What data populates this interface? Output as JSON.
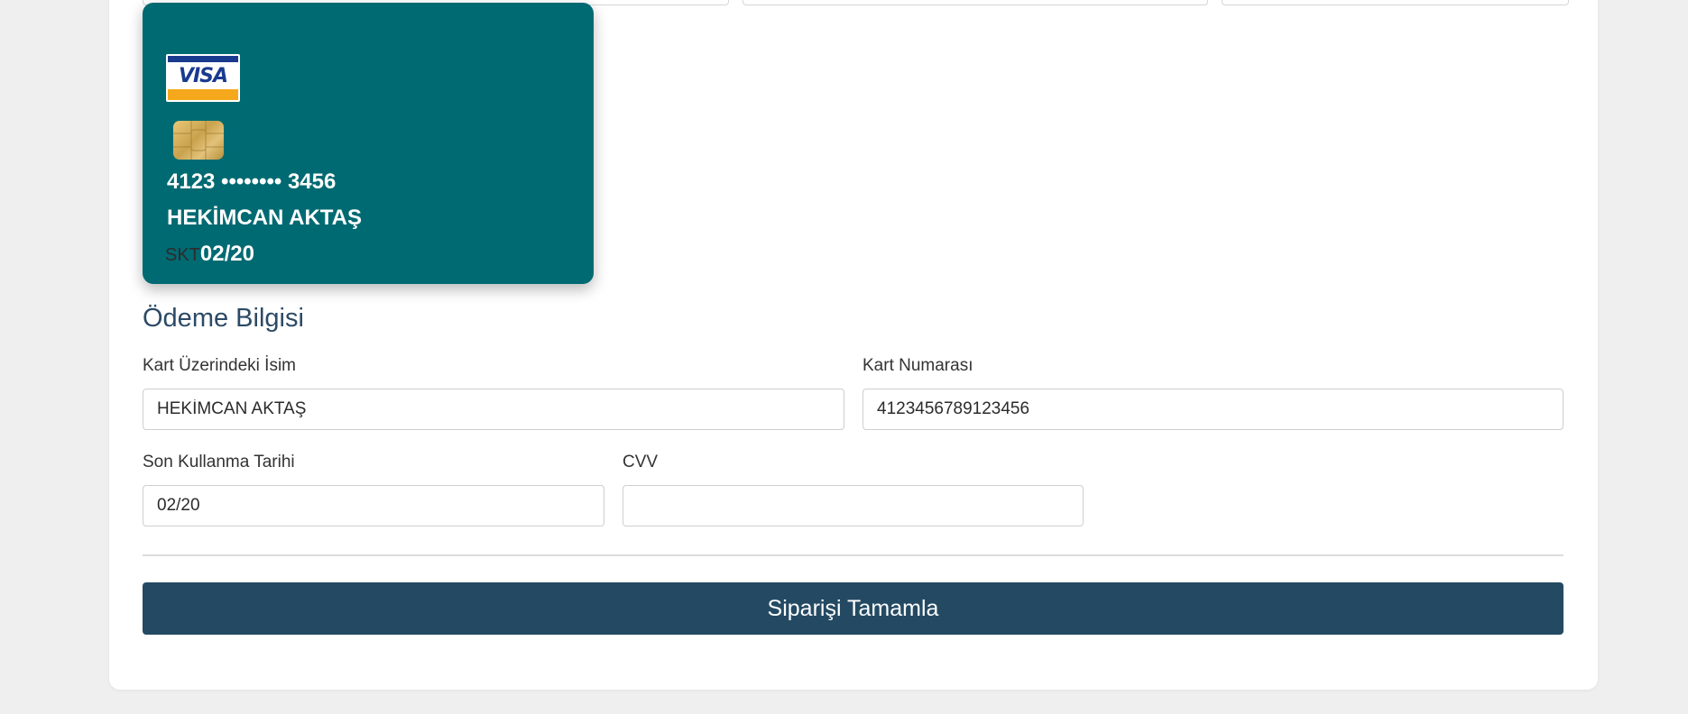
{
  "card_preview": {
    "brand": "VISA",
    "number_masked": "4123 •••••••• 3456",
    "holder": "HEKİMCAN AKTAŞ",
    "expiry_label": "SKT",
    "expiry": "02/20",
    "background_color": "#006a72"
  },
  "payment": {
    "title": "Ödeme Bilgisi",
    "name_label": "Kart Üzerindeki İsim",
    "name_value": "HEKİMCAN AKTAŞ",
    "number_label": "Kart Numarası",
    "number_value": "4123456789123456",
    "expiry_label": "Son Kullanma Tarihi",
    "expiry_value": "02/20",
    "cvv_label": "CVV",
    "cvv_value": ""
  },
  "actions": {
    "submit_label": "Siparişi Tamamla",
    "submit_color": "#244a63"
  }
}
